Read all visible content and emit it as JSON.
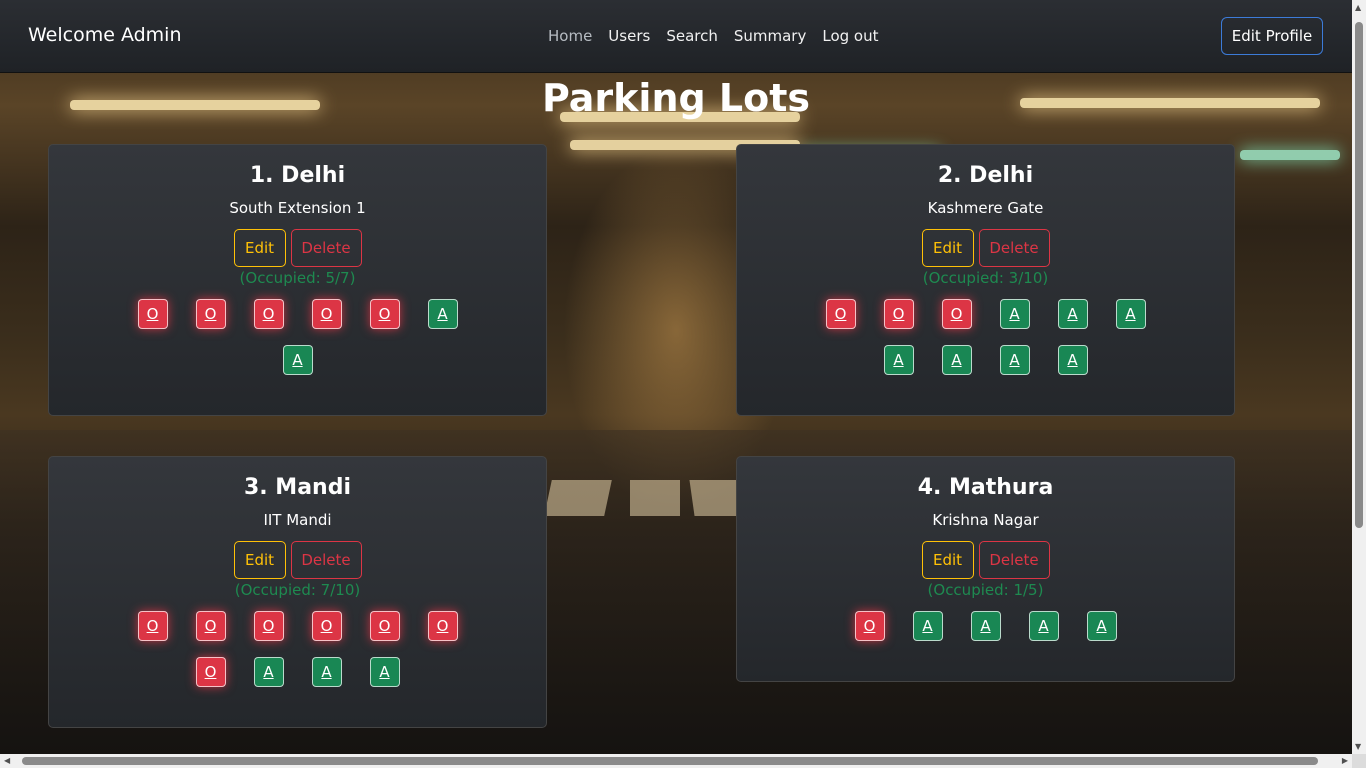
{
  "nav": {
    "brand": "Welcome Admin",
    "links": [
      "Home",
      "Users",
      "Search",
      "Summary",
      "Log out"
    ],
    "active": "Home",
    "edit_profile": "Edit Profile"
  },
  "page_title": "Parking Lots",
  "colors": {
    "occupied": "#dc3545",
    "available": "#198754",
    "edit": "#ffc107",
    "delete": "#dc3545",
    "profile_border": "#3c7bd8"
  },
  "lots": [
    {
      "title": "1. Delhi",
      "location": "South Extension 1",
      "edit_label": "Edit",
      "delete_label": "Delete",
      "occupied_text": "(Occupied: 5/7)",
      "spots": [
        "O",
        "O",
        "O",
        "O",
        "O",
        "A",
        "A"
      ]
    },
    {
      "title": "2. Delhi",
      "location": "Kashmere Gate",
      "edit_label": "Edit",
      "delete_label": "Delete",
      "occupied_text": "(Occupied: 3/10)",
      "spots": [
        "O",
        "O",
        "O",
        "A",
        "A",
        "A",
        "A",
        "A",
        "A",
        "A"
      ]
    },
    {
      "title": "3. Mandi",
      "location": "IIT Mandi",
      "edit_label": "Edit",
      "delete_label": "Delete",
      "occupied_text": "(Occupied: 7/10)",
      "spots": [
        "O",
        "O",
        "O",
        "O",
        "O",
        "O",
        "O",
        "A",
        "A",
        "A"
      ]
    },
    {
      "title": "4. Mathura",
      "location": "Krishna Nagar",
      "edit_label": "Edit",
      "delete_label": "Delete",
      "occupied_text": "(Occupied: 1/5)",
      "spots": [
        "O",
        "A",
        "A",
        "A",
        "A"
      ]
    }
  ]
}
